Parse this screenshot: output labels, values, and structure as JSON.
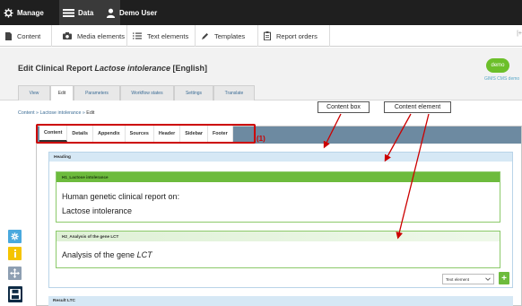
{
  "topbar": {
    "manage": "Manage",
    "data": "Data",
    "user": "Demo User"
  },
  "subnav": {
    "content": "Content",
    "media": "Media elements",
    "text": "Text elements",
    "templates": "Templates",
    "reports": "Report orders"
  },
  "header": {
    "title_prefix": "Edit Clinical Report ",
    "title_italic": "Lactose intolerance",
    "title_suffix": " [English]",
    "logo": "demo",
    "logo_caption": "GIMS CMS demo",
    "tabs": [
      "View",
      "Edit",
      "Parameters",
      "Workflow states",
      "Settings",
      "Translate"
    ]
  },
  "breadcrumb": {
    "root": "Content",
    "sep1": " » ",
    "item": "Lactose intolerance",
    "sep2": " » ",
    "current": "Edit"
  },
  "callouts": {
    "content_box": "Content box",
    "content_element": "Content element",
    "marker": "(1)"
  },
  "panel": {
    "tabs": [
      "Content",
      "Details",
      "Appendix",
      "Sources",
      "Header",
      "Sidebar",
      "Footer"
    ]
  },
  "content_box": {
    "heading": "Heading",
    "element1": {
      "label": "H1_Lactose intolerance",
      "line1": "Human genetic clinical report on:",
      "line2": "Lactose intolerance"
    },
    "element2": {
      "label": "H2_Analysis of the gene LCT",
      "body_prefix": "Analysis of the gene ",
      "body_italic": "LCT"
    },
    "select_value": "Text element",
    "add_label": "+"
  },
  "result_box": {
    "heading": "Result LTC"
  },
  "colors": {
    "topbar": "#1f1f1f",
    "panel_bar": "#6d8aa1",
    "element_green": "#6dbb3d",
    "annotation_red": "#cc0000",
    "box_blue": "#d6e8f5"
  },
  "icons": {
    "manage": "gear-icon",
    "data": "menu-icon",
    "user": "user-icon",
    "content": "document-icon",
    "media": "camera-icon",
    "text": "list-icon",
    "templates": "pen-icon",
    "reports": "clipboard-icon",
    "toolbar": [
      "gear-icon",
      "info-icon",
      "move-icon",
      "save-icon"
    ]
  }
}
